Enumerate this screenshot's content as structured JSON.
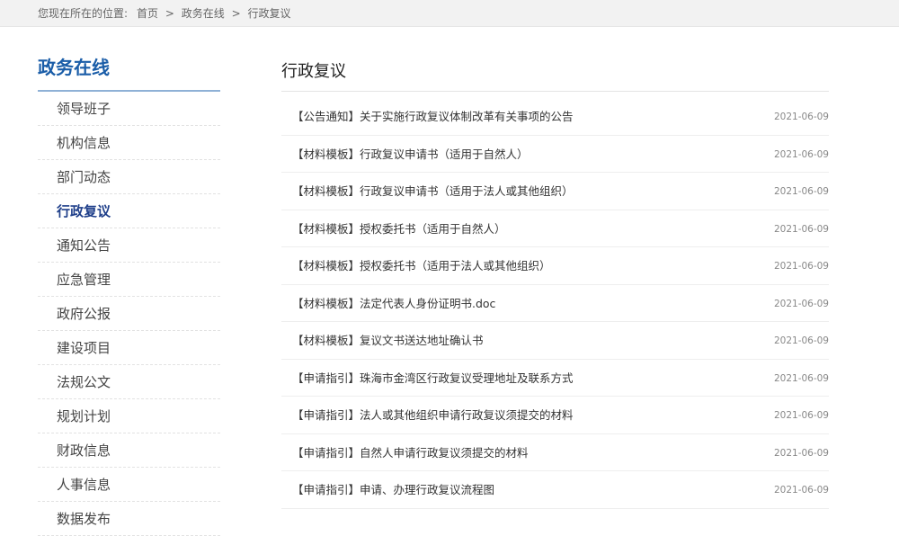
{
  "breadcrumb": {
    "prefix": "您现在所在的位置:",
    "items": [
      "首页",
      "政务在线",
      "行政复议"
    ],
    "separator": ">"
  },
  "sidebar": {
    "title": "政务在线",
    "active_index": 4,
    "items": [
      {
        "label": "领导班子"
      },
      {
        "label": "机构信息"
      },
      {
        "label": "部门动态"
      },
      {
        "label": "行政复议"
      },
      {
        "label": "通知公告"
      },
      {
        "label": "应急管理"
      },
      {
        "label": "政府公报"
      },
      {
        "label": "建设项目"
      },
      {
        "label": "法规公文"
      },
      {
        "label": "规划计划"
      },
      {
        "label": "财政信息"
      },
      {
        "label": "人事信息"
      },
      {
        "label": "数据发布"
      }
    ]
  },
  "main": {
    "title": "行政复议",
    "items": [
      {
        "title": "【公告通知】关于实施行政复议体制改革有关事项的公告",
        "date": "2021-06-09"
      },
      {
        "title": "【材料模板】行政复议申请书（适用于自然人）",
        "date": "2021-06-09"
      },
      {
        "title": "【材料模板】行政复议申请书（适用于法人或其他组织）",
        "date": "2021-06-09"
      },
      {
        "title": "【材料模板】授权委托书（适用于自然人）",
        "date": "2021-06-09"
      },
      {
        "title": "【材料模板】授权委托书（适用于法人或其他组织）",
        "date": "2021-06-09"
      },
      {
        "title": "【材料模板】法定代表人身份证明书.doc",
        "date": "2021-06-09"
      },
      {
        "title": "【材料模板】复议文书送达地址确认书",
        "date": "2021-06-09"
      },
      {
        "title": "【申请指引】珠海市金湾区行政复议受理地址及联系方式",
        "date": "2021-06-09"
      },
      {
        "title": "【申请指引】法人或其他组织申请行政复议须提交的材料",
        "date": "2021-06-09"
      },
      {
        "title": "【申请指引】自然人申请行政复议须提交的材料",
        "date": "2021-06-09"
      },
      {
        "title": "【申请指引】申请、办理行政复议流程图",
        "date": "2021-06-09"
      }
    ]
  },
  "colors": {
    "accent": "#1a5da8",
    "active_nav": "#1f3f8a",
    "topbar_bg": "#f2f2f2"
  }
}
